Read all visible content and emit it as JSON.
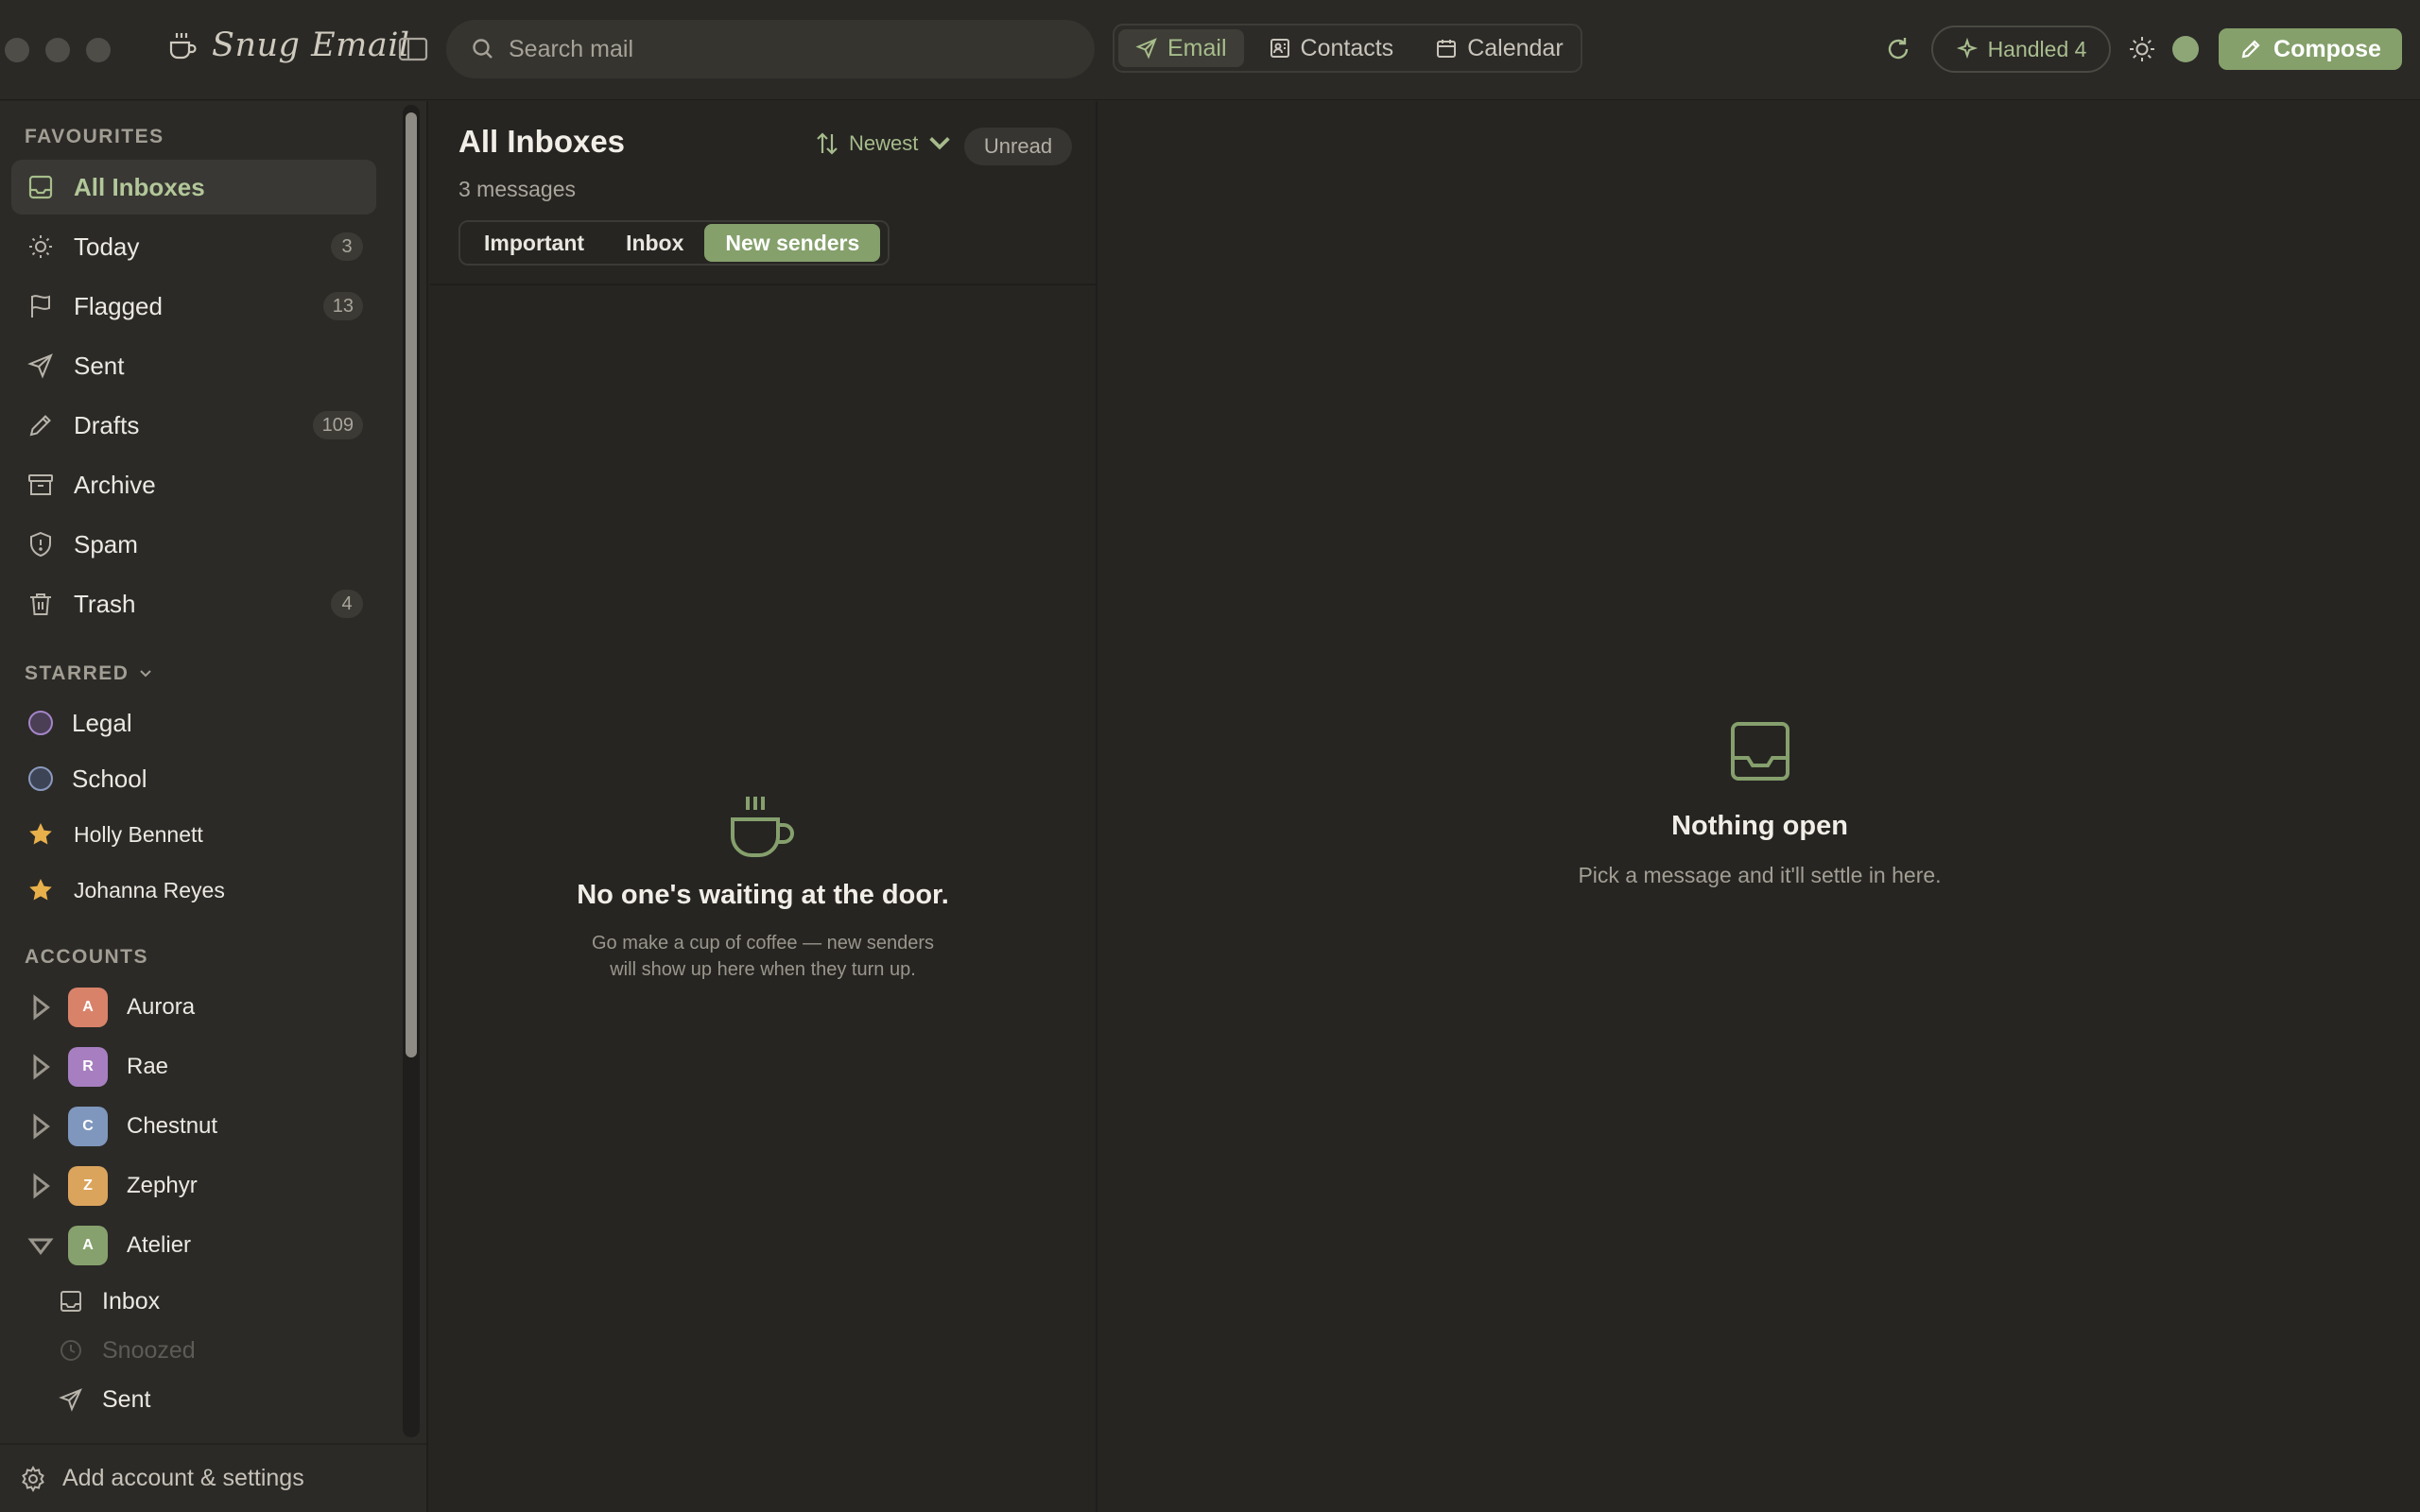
{
  "app": {
    "name": "Snug Email"
  },
  "search": {
    "placeholder": "Search mail"
  },
  "modes": [
    {
      "label": "Email",
      "icon": "send-icon",
      "active": true
    },
    {
      "label": "Contacts",
      "icon": "contacts-icon",
      "active": false
    },
    {
      "label": "Calendar",
      "icon": "calendar-icon",
      "active": false
    }
  ],
  "toolbar": {
    "handled_label": "Handled 4",
    "compose_label": "Compose"
  },
  "sidebar": {
    "favourites_heading": "FAVOURITES",
    "favourites": [
      {
        "label": "All Inboxes",
        "icon": "inbox-icon",
        "count": "",
        "active": true
      },
      {
        "label": "Today",
        "icon": "sun-icon",
        "count": "3"
      },
      {
        "label": "Flagged",
        "icon": "flag-icon",
        "count": "13"
      },
      {
        "label": "Sent",
        "icon": "send-icon",
        "count": ""
      },
      {
        "label": "Drafts",
        "icon": "pencil-icon",
        "count": "109"
      },
      {
        "label": "Archive",
        "icon": "archive-icon",
        "count": ""
      },
      {
        "label": "Spam",
        "icon": "shield-icon",
        "count": ""
      },
      {
        "label": "Trash",
        "icon": "trash-icon",
        "count": "4"
      }
    ],
    "starred_heading": "STARRED",
    "starred": [
      {
        "label": "Legal",
        "type": "circle",
        "color": "#a585c9"
      },
      {
        "label": "School",
        "type": "circle",
        "color": "#8a99bd"
      },
      {
        "label": "Holly Bennett",
        "type": "star",
        "color": "#e8b04b"
      },
      {
        "label": "Johanna Reyes",
        "type": "star",
        "color": "#e8b04b"
      }
    ],
    "accounts_heading": "ACCOUNTS",
    "accounts": [
      {
        "label": "Aurora",
        "initial": "A",
        "color": "#d9826a",
        "expanded": false
      },
      {
        "label": "Rae",
        "initial": "R",
        "color": "#a77fc0",
        "expanded": false
      },
      {
        "label": "Chestnut",
        "initial": "C",
        "color": "#7f97bd",
        "expanded": false
      },
      {
        "label": "Zephyr",
        "initial": "Z",
        "color": "#dba45d",
        "expanded": false
      },
      {
        "label": "Atelier",
        "initial": "A",
        "color": "#86a16d",
        "expanded": true
      }
    ],
    "atelier_folders": [
      {
        "label": "Inbox",
        "icon": "inbox-icon",
        "dim": false
      },
      {
        "label": "Snoozed",
        "icon": "clock-icon",
        "dim": true
      },
      {
        "label": "Sent",
        "icon": "send-icon",
        "dim": false
      }
    ],
    "footer_label": "Add account & settings"
  },
  "message_list": {
    "title": "All Inboxes",
    "subtitle": "3 messages",
    "sort_label": "Newest",
    "unread_label": "Unread",
    "tabs": [
      {
        "label": "Important",
        "active": false
      },
      {
        "label": "Inbox",
        "active": false
      },
      {
        "label": "New senders",
        "active": true
      }
    ],
    "empty_title": "No one's waiting at the door.",
    "empty_desc": "Go make a cup of coffee — new senders will show up here when they turn up."
  },
  "reader": {
    "empty_title": "Nothing open",
    "empty_desc": "Pick a message and it'll settle in here."
  },
  "colors": {
    "accent": "#85a06b",
    "accent_text": "#a7bd8b",
    "background": "#262522",
    "sidebar": "#2b2a27"
  }
}
